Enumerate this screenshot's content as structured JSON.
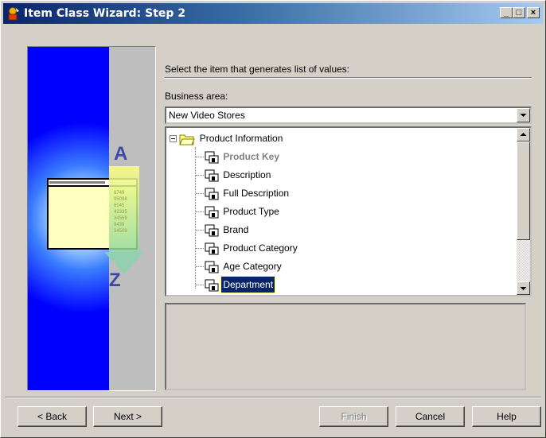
{
  "window": {
    "title": "Item Class Wizard: Step 2",
    "controls": {
      "minimize": "_",
      "maximize": "□",
      "close": "×"
    }
  },
  "instruction": "Select the item that generates list of values:",
  "business_area": {
    "label": "Business area:",
    "value": "New Video Stores"
  },
  "tree": {
    "root": "Product Information",
    "items": [
      {
        "label": "Product Key",
        "state": "disabled"
      },
      {
        "label": "Description",
        "state": "normal"
      },
      {
        "label": "Full Description",
        "state": "normal"
      },
      {
        "label": "Product Type",
        "state": "normal"
      },
      {
        "label": "Brand",
        "state": "normal"
      },
      {
        "label": "Product Category",
        "state": "normal"
      },
      {
        "label": "Age Category",
        "state": "normal"
      },
      {
        "label": "Department",
        "state": "selected"
      }
    ]
  },
  "illustration": {
    "letter_top": "A",
    "letter_bottom": "Z",
    "numbers": [
      "6749",
      "95098",
      "6045",
      "42335",
      "34559",
      "9439",
      "34509"
    ]
  },
  "buttons": {
    "back": "< Back",
    "next": "Next >",
    "finish": "Finish",
    "cancel": "Cancel",
    "help": "Help"
  },
  "colors": {
    "title_bar_start": "#0a246a",
    "title_bar_end": "#a6caf0",
    "selection": "#0a246a",
    "panel_blue": "#0000ff",
    "face": "#d4d0c8"
  }
}
